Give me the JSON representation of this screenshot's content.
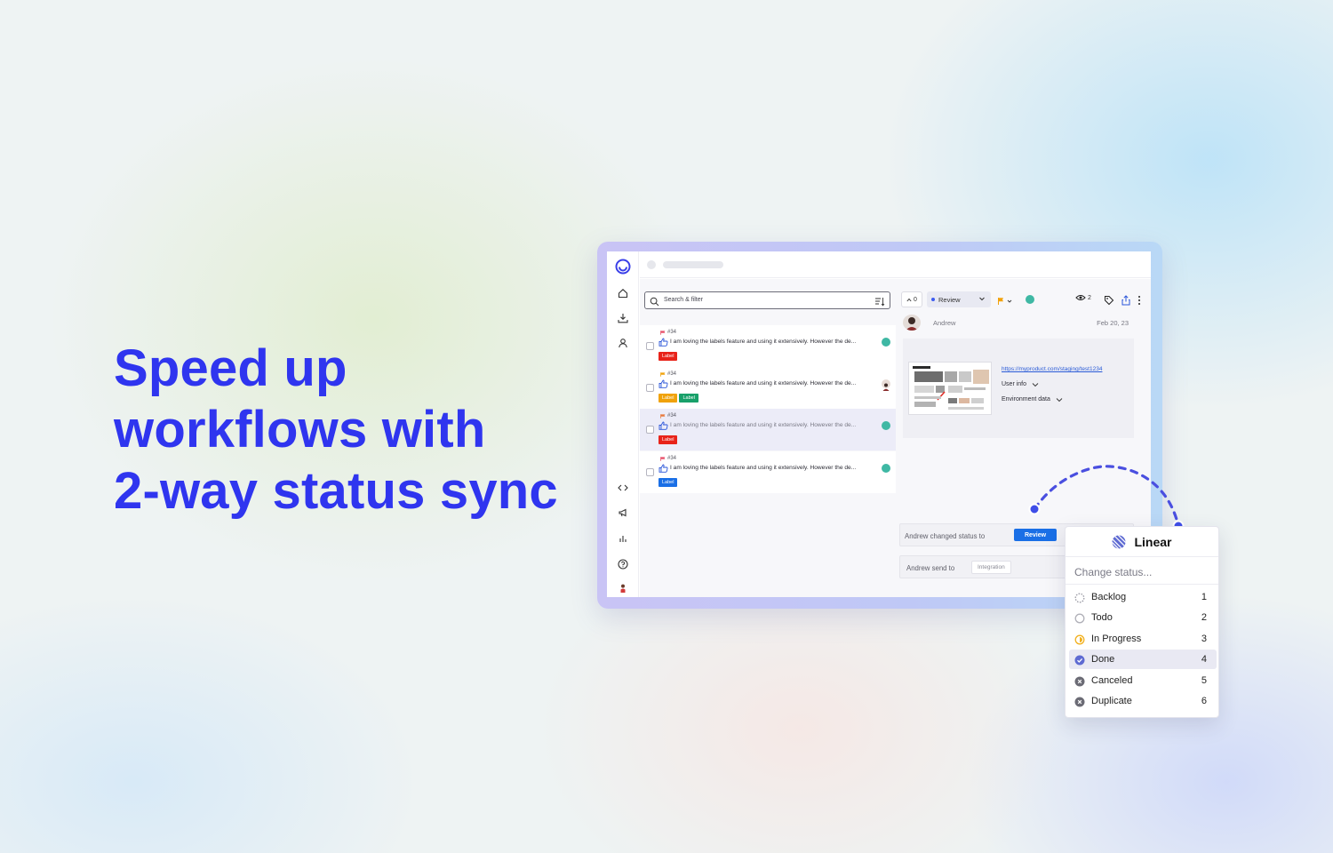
{
  "headline": {
    "line1": "Speed up",
    "line2": "workflows with",
    "line3": "2-way status sync"
  },
  "search": {
    "placeholder": "Search & filter"
  },
  "feedback": [
    {
      "id": "#34",
      "text": "I am loving the labels feature and using it extensively. However the de...",
      "labels": [
        "Label"
      ],
      "label_colors": [
        "#e8231a"
      ],
      "flag_color": "#e8506a",
      "selected": false
    },
    {
      "id": "#34",
      "text": "I am loving the labels feature and using it extensively. However the de...",
      "labels": [
        "Label",
        "Label"
      ],
      "label_colors": [
        "#f0a20a",
        "#18a06a"
      ],
      "flag_color": "#f0a20a",
      "selected": false
    },
    {
      "id": "#34",
      "text": "I am loving the labels feature and using it extensively. However the de...",
      "labels": [
        "Label"
      ],
      "label_colors": [
        "#e8231a"
      ],
      "flag_color": "#e87a3c",
      "selected": true
    },
    {
      "id": "#34",
      "text": "I am loving the labels feature and using it extensively. However the de...",
      "labels": [
        "Label"
      ],
      "label_colors": [
        "#1a6fe6"
      ],
      "flag_color": "#e8506a",
      "selected": false
    }
  ],
  "detail": {
    "vote_count": "0",
    "status": "Review",
    "watchers": "2",
    "author": "Andrew",
    "date": "Feb 20, 23",
    "link": "https://myproduct.com/staging/test1234",
    "user_info": "User info",
    "env_data": "Environment data",
    "activity1_text": "Andrew changed status to",
    "activity1_badge": "Review",
    "activity2_text": "Andrew send to",
    "activity2_badge": "Integration"
  },
  "linear": {
    "title": "Linear",
    "prompt": "Change status...",
    "options": [
      {
        "label": "Backlog",
        "num": "1",
        "icon": "backlog-icon"
      },
      {
        "label": "Todo",
        "num": "2",
        "icon": "todo-icon"
      },
      {
        "label": "In Progress",
        "num": "3",
        "icon": "in-progress-icon"
      },
      {
        "label": "Done",
        "num": "4",
        "icon": "done-icon",
        "active": true
      },
      {
        "label": "Canceled",
        "num": "5",
        "icon": "canceled-icon"
      },
      {
        "label": "Duplicate",
        "num": "6",
        "icon": "duplicate-icon"
      }
    ]
  },
  "colors": {
    "brand_blue": "#2f35ef",
    "status_blue": "#1a6fe6",
    "linear_purple": "#5e6ad2",
    "progress_yellow": "#f2b01e"
  }
}
